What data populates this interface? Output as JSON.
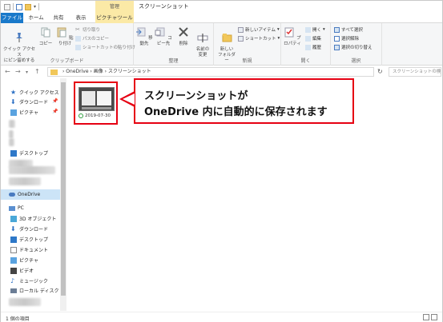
{
  "titlebar": {
    "context_tab": "管理",
    "title": "スクリーンショット"
  },
  "tabs": {
    "file": "ファイル",
    "home": "ホーム",
    "share": "共有",
    "view": "表示",
    "picture_tools": "ピクチャツール"
  },
  "ribbon": {
    "clipboard": {
      "pin_quick_access": "クイック アクセス\nにピン留めする",
      "copy": "コピー",
      "paste": "貼り付け",
      "cut": "切り取り",
      "copy_path": "パスのコピー",
      "paste_shortcut": "ショートカットの貼り付け",
      "label": "クリップボード"
    },
    "organize": {
      "move_to": "移動先",
      "copy_to": "コピー先",
      "delete": "削除",
      "rename": "名前の\n変更",
      "label": "整理"
    },
    "new": {
      "new_folder": "新しい\nフォルダー",
      "new_item": "新しいアイテム",
      "easy_access": "ショートカット",
      "label": "新規"
    },
    "open": {
      "properties": "プロパティ",
      "open": "開く",
      "edit": "編集",
      "history": "履歴",
      "label": "開く"
    },
    "select": {
      "select_all": "すべて選択",
      "select_none": "選択解除",
      "invert": "選択の切り替え",
      "label": "選択"
    }
  },
  "address": {
    "path": "› OneDrive › 画像 › スクリーンショット",
    "search_placeholder": "スクリーンショットの検"
  },
  "nav": {
    "quick_access": "クイック アクセス",
    "downloads": "ダウンロード",
    "pictures": "ピクチャ",
    "desktop": "デスクトップ",
    "onedrive": "OneDrive",
    "pc": "PC",
    "objects3d": "3D オブジェクト",
    "pc_downloads": "ダウンロード",
    "pc_desktop": "デスクトップ",
    "documents": "ドキュメント",
    "pc_pictures": "ピクチャ",
    "videos": "ビデオ",
    "music": "ミュージック",
    "local_disk": "ローカル ディスク (C"
  },
  "file": {
    "name": "2019-07-30"
  },
  "callout": {
    "line1": "スクリーンショットが",
    "line2": "OneDrive 内に自動的に保存されます"
  },
  "status": {
    "count": "1 個の項目"
  },
  "colors": {
    "accent": "#1979ca",
    "highlight_red": "#e60012",
    "context_tab": "#fbe9a6",
    "selection": "#cce4f7"
  }
}
